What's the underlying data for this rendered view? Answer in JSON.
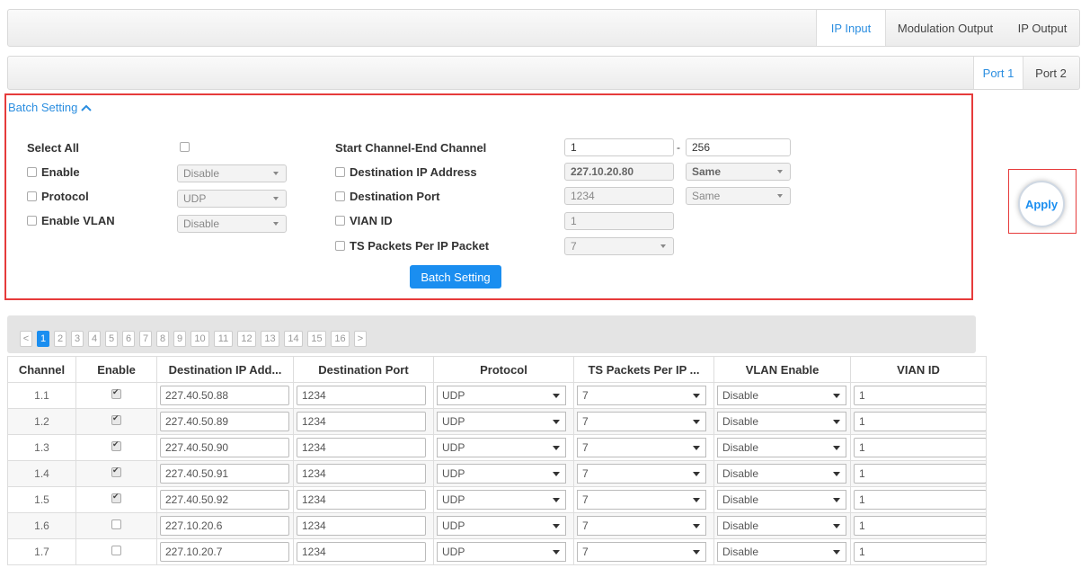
{
  "top_tabs": [
    {
      "label": "IP Input",
      "active": true
    },
    {
      "label": "Modulation Output",
      "active": false
    },
    {
      "label": "IP Output",
      "active": false
    }
  ],
  "port_tabs": [
    {
      "label": "Port 1",
      "active": true
    },
    {
      "label": "Port 2",
      "active": false
    }
  ],
  "batch": {
    "toggle_label": "Batch Setting",
    "select_all": "Select All",
    "enable": {
      "label": "Enable",
      "value": "Disable"
    },
    "protocol": {
      "label": "Protocol",
      "value": "UDP"
    },
    "enable_vlan": {
      "label": "Enable VLAN",
      "value": "Disable"
    },
    "channel_range": {
      "label": "Start Channel-End Channel",
      "start": "1",
      "dash": "-",
      "end": "256"
    },
    "dest_ip": {
      "label": "Destination IP Address",
      "value": "227.10.20.80",
      "mode": "Same"
    },
    "dest_port": {
      "label": "Destination Port",
      "value": "1234",
      "mode": "Same"
    },
    "vlan_id": {
      "label": "VIAN ID",
      "value": "1"
    },
    "ts_packets": {
      "label": "TS Packets Per IP Packet",
      "value": "7"
    },
    "button": "Batch Setting"
  },
  "apply": "Apply",
  "pager": {
    "prev": "<",
    "next": ">",
    "pages": [
      "1",
      "2",
      "3",
      "4",
      "5",
      "6",
      "7",
      "8",
      "9",
      "10",
      "11",
      "12",
      "13",
      "14",
      "15",
      "16"
    ],
    "active_page": "1"
  },
  "table": {
    "headers": [
      "Channel",
      "Enable",
      "Destination IP Add...",
      "Destination Port",
      "Protocol",
      "TS Packets Per IP ...",
      "VLAN Enable",
      "VIAN ID"
    ],
    "rows": [
      {
        "channel": "1.1",
        "enabled": true,
        "ip": "227.40.50.88",
        "port": "1234",
        "protocol": "UDP",
        "ts": "7",
        "vlan": "Disable",
        "vlan_id": "1"
      },
      {
        "channel": "1.2",
        "enabled": true,
        "ip": "227.40.50.89",
        "port": "1234",
        "protocol": "UDP",
        "ts": "7",
        "vlan": "Disable",
        "vlan_id": "1"
      },
      {
        "channel": "1.3",
        "enabled": true,
        "ip": "227.40.50.90",
        "port": "1234",
        "protocol": "UDP",
        "ts": "7",
        "vlan": "Disable",
        "vlan_id": "1"
      },
      {
        "channel": "1.4",
        "enabled": true,
        "ip": "227.40.50.91",
        "port": "1234",
        "protocol": "UDP",
        "ts": "7",
        "vlan": "Disable",
        "vlan_id": "1"
      },
      {
        "channel": "1.5",
        "enabled": true,
        "ip": "227.40.50.92",
        "port": "1234",
        "protocol": "UDP",
        "ts": "7",
        "vlan": "Disable",
        "vlan_id": "1"
      },
      {
        "channel": "1.6",
        "enabled": false,
        "ip": "227.10.20.6",
        "port": "1234",
        "protocol": "UDP",
        "ts": "7",
        "vlan": "Disable",
        "vlan_id": "1"
      },
      {
        "channel": "1.7",
        "enabled": false,
        "ip": "227.10.20.7",
        "port": "1234",
        "protocol": "UDP",
        "ts": "7",
        "vlan": "Disable",
        "vlan_id": "1"
      }
    ]
  }
}
